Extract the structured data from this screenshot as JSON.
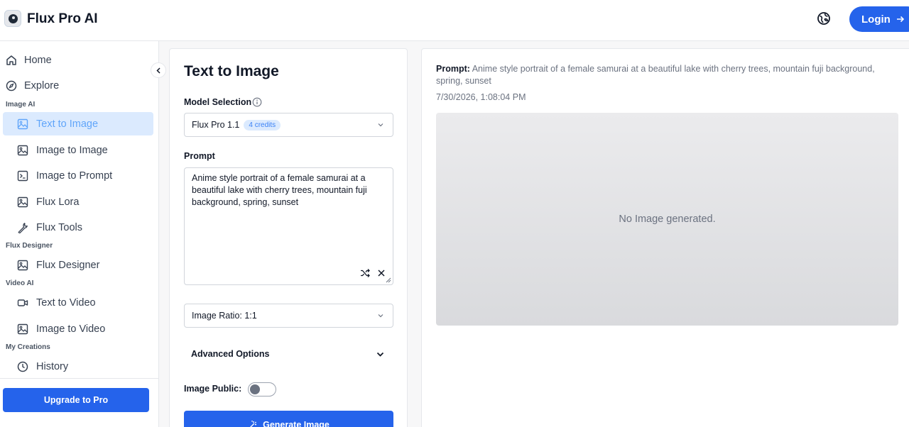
{
  "header": {
    "app_title": "Flux Pro AI",
    "login_label": "Login"
  },
  "sidebar": {
    "home": "Home",
    "explore": "Explore",
    "sections": {
      "image_ai": "Image AI",
      "flux_designer": "Flux Designer",
      "video_ai": "Video AI",
      "my_creations": "My Creations"
    },
    "items": {
      "text_to_image": "Text to Image",
      "image_to_image": "Image to Image",
      "image_to_prompt": "Image to Prompt",
      "flux_lora": "Flux Lora",
      "flux_tools": "Flux Tools",
      "flux_designer": "Flux Designer",
      "text_to_video": "Text to Video",
      "image_to_video": "Image to Video",
      "history": "History"
    },
    "active_item": "Text to Image",
    "upgrade_label": "Upgrade to Pro"
  },
  "form": {
    "title": "Text to Image",
    "model_label": "Model Selection",
    "model_value": "Flux Pro 1.1",
    "model_badge": "4 credits",
    "prompt_label": "Prompt",
    "prompt_value": "Anime style portrait of a female samurai at a beautiful lake with cherry trees, mountain fuji background, spring, sunset",
    "ratio_value": "Image Ratio: 1:1",
    "advanced_label": "Advanced Options",
    "public_label": "Image Public:",
    "public_enabled": false,
    "generate_label": "Generate Image"
  },
  "result": {
    "prompt_label": "Prompt:",
    "prompt_text": "Anime style portrait of a female samurai at a beautiful lake with cherry trees, mountain fuji background, spring, sunset",
    "timestamp": "7/30/2026, 1:08:04 PM",
    "empty_text": "No Image generated."
  },
  "colors": {
    "accent": "#2563eb",
    "active_bg": "#dbeafe",
    "active_text": "#60a5fa"
  }
}
